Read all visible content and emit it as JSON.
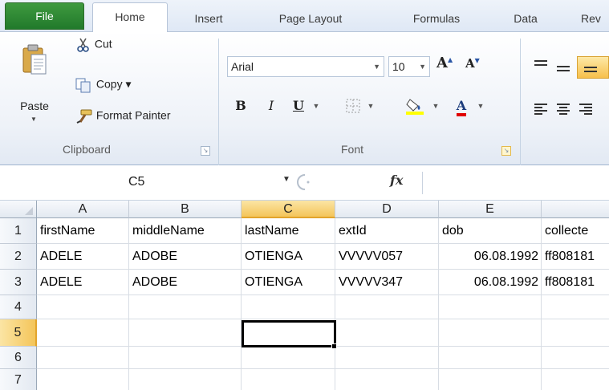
{
  "tabs": [
    "File",
    "Home",
    "Insert",
    "Page Layout",
    "Formulas",
    "Data",
    "Rev"
  ],
  "clipboard": {
    "paste_label": "Paste",
    "cut_label": "Cut",
    "copy_label": "Copy ▾",
    "format_painter_label": "Format Painter",
    "group_label": "Clipboard"
  },
  "font": {
    "font_name": "Arial",
    "font_size": "10",
    "bold": "B",
    "italic": "I",
    "underline": "U",
    "font_color_letter": "A",
    "grow_letter": "A",
    "shrink_letter": "A",
    "group_label": "Font",
    "highlight_color": "#ffff00",
    "font_color": "#e00000"
  },
  "formula_bar": {
    "name_box": "C5",
    "fx": "fx",
    "formula": ""
  },
  "grid": {
    "columns": [
      "A",
      "B",
      "C",
      "D",
      "E",
      ""
    ],
    "selected_column": "C",
    "rows": [
      {
        "num": "1",
        "cells": [
          "firstName",
          "middleName",
          "lastName",
          "extId",
          "dob",
          "collecte"
        ]
      },
      {
        "num": "2",
        "cells": [
          "ADELE",
          "ADOBE",
          "OTIENGA",
          "VVVVV057",
          "06.08.1992",
          "ff808181"
        ]
      },
      {
        "num": "3",
        "cells": [
          "ADELE",
          "ADOBE",
          "OTIENGA",
          "VVVVV347",
          "06.08.1992",
          "ff808181"
        ]
      },
      {
        "num": "4",
        "cells": [
          "",
          "",
          "",
          "",
          "",
          ""
        ]
      },
      {
        "num": "5",
        "cells": [
          "",
          "",
          "",
          "",
          "",
          ""
        ]
      },
      {
        "num": "6",
        "cells": [
          "",
          "",
          "",
          "",
          "",
          ""
        ]
      },
      {
        "num": "7",
        "cells": [
          "",
          "",
          "",
          "",
          "",
          ""
        ]
      }
    ],
    "selected_row": "5",
    "active_cell": "C5"
  }
}
